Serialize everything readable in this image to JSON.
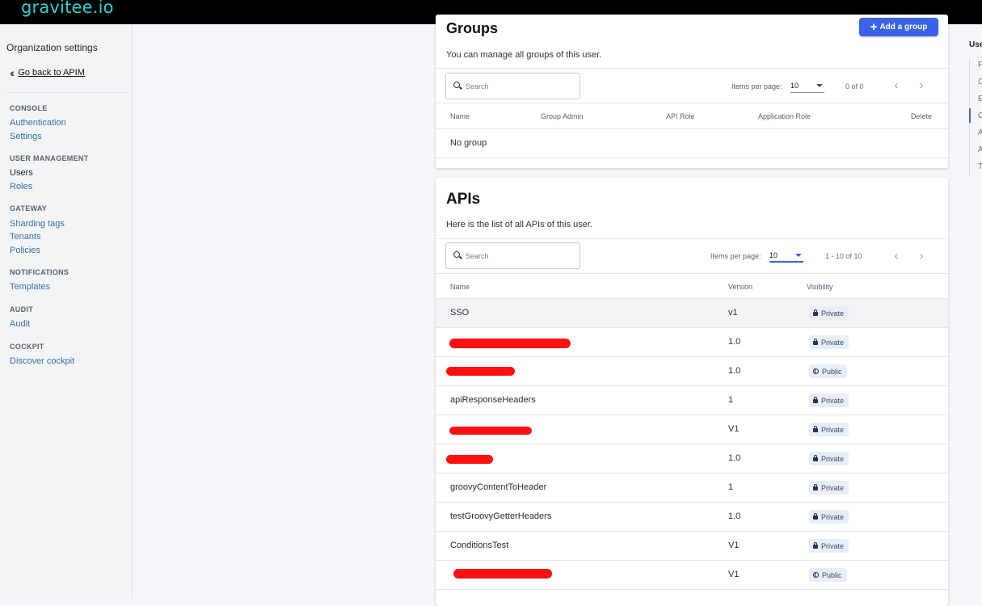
{
  "app": {
    "logo": "gravitee.io"
  },
  "sidebar": {
    "title": "Organization settings",
    "back_label": "Go back to APIM",
    "sections": [
      {
        "title": "CONSOLE",
        "items": [
          "Authentication",
          "Settings"
        ]
      },
      {
        "title": "USER MANAGEMENT",
        "items": [
          "Users",
          "Roles"
        ]
      },
      {
        "title": "GATEWAY",
        "items": [
          "Sharding tags",
          "Tenants",
          "Policies"
        ]
      },
      {
        "title": "NOTIFICATIONS",
        "items": [
          "Templates"
        ]
      },
      {
        "title": "AUDIT",
        "items": [
          "Audit"
        ]
      },
      {
        "title": "COCKPIT",
        "items": [
          "Discover cockpit"
        ]
      }
    ],
    "active_item": "Users"
  },
  "right_rail": {
    "title": "Use",
    "items": [
      "P",
      "O",
      "E",
      "G",
      "A",
      "A",
      "T"
    ]
  },
  "groups": {
    "title": "Groups",
    "subtitle": "You can manage all groups of this user.",
    "add_label": "Add a group",
    "search_placeholder": "Search",
    "items_per_page_label": "Items per page:",
    "items_per_page": "10",
    "range": "0 of 0",
    "columns": [
      "Name",
      "Group Admin",
      "API Role",
      "Application Role",
      "Delete"
    ],
    "empty_text": "No group"
  },
  "apis": {
    "title": "APIs",
    "subtitle": "Here is the list of all APIs of this user.",
    "search_placeholder": "Search",
    "items_per_page_label": "Items per page:",
    "items_per_page": "10",
    "range": "1 - 10 of 10",
    "columns": [
      "Name",
      "Version",
      "Visibility"
    ],
    "rows": [
      {
        "name": "SSO",
        "version": "v1",
        "visibility": "Private"
      },
      {
        "name": "",
        "version": "1.0",
        "visibility": "Private"
      },
      {
        "name": "",
        "version": "1.0",
        "visibility": "Public"
      },
      {
        "name": "apiResponseHeaders",
        "version": "1",
        "visibility": "Private"
      },
      {
        "name": "",
        "version": "V1",
        "visibility": "Private"
      },
      {
        "name": "",
        "version": "1.0",
        "visibility": "Private"
      },
      {
        "name": "groovyContentToHeader",
        "version": "1",
        "visibility": "Private"
      },
      {
        "name": "testGroovyGetterHeaders",
        "version": "1.0",
        "visibility": "Private"
      },
      {
        "name": "ConditionsTest",
        "version": "V1",
        "visibility": "Private"
      },
      {
        "name": "",
        "version": "V1",
        "visibility": "Public"
      }
    ]
  },
  "colors": {
    "accent": "#3b63e8",
    "link": "#3b6ea8",
    "logo": "#27d4d6",
    "redaction": "#ff1010"
  }
}
